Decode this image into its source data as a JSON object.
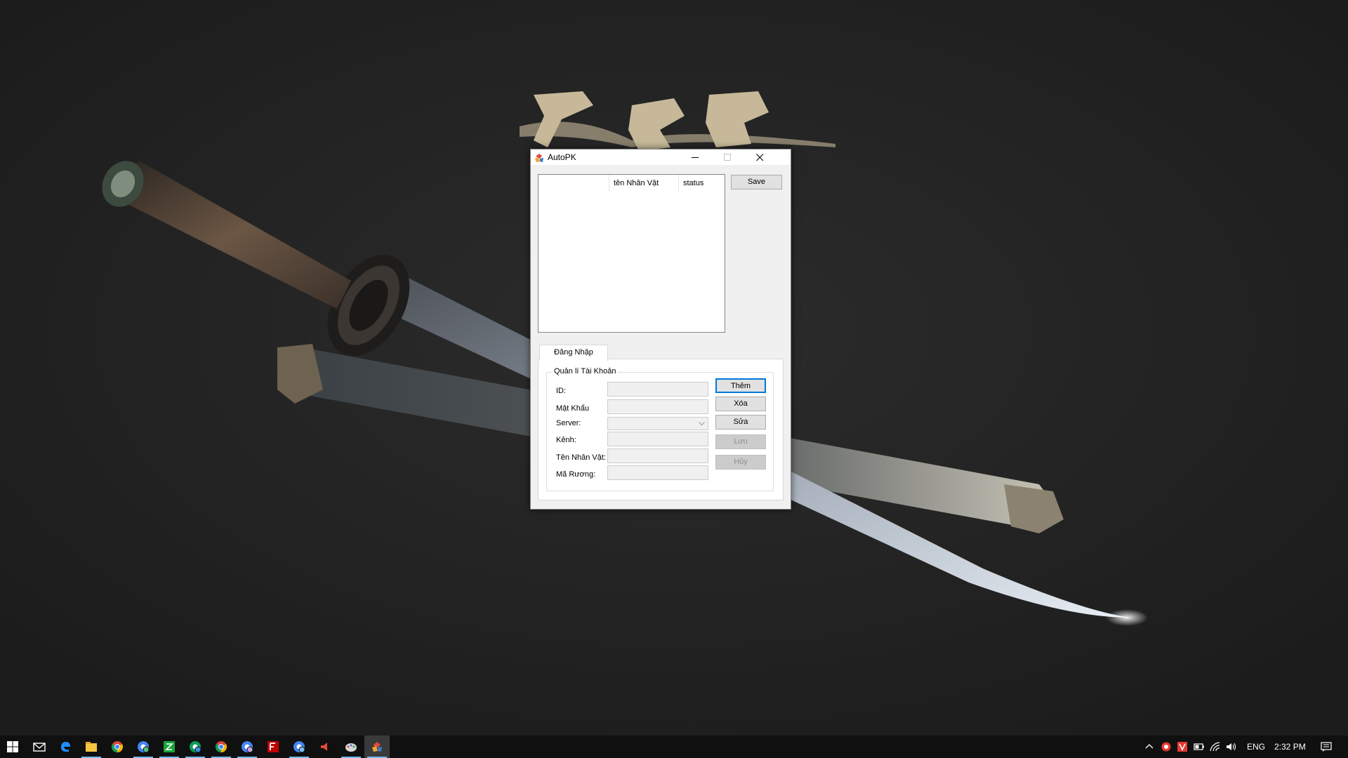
{
  "window": {
    "title": "AutoPK",
    "icon": "app-logo-icon",
    "controls": [
      "minimize-icon",
      "maximize-icon",
      "close-icon"
    ]
  },
  "listview": {
    "columns": [
      "",
      "tên Nhân Vật",
      "status"
    ],
    "rows": []
  },
  "toolbar": {
    "save_label": "Save"
  },
  "tabs": [
    {
      "label": "Đăng Nhập",
      "selected": true
    }
  ],
  "account_group": {
    "title": "Quản lí Tài Khoản",
    "fields": {
      "id": {
        "label": "ID:",
        "value": ""
      },
      "password": {
        "label": "Mật Khẩu",
        "value": ""
      },
      "server": {
        "label": "Server:",
        "value": ""
      },
      "channel": {
        "label": "Kênh:",
        "value": ""
      },
      "character": {
        "label": "Tên Nhân Vật:",
        "value": ""
      },
      "chest_code": {
        "label": "Mã Rương:",
        "value": ""
      }
    },
    "buttons": {
      "add": {
        "label": "Thêm",
        "enabled": true,
        "default": true
      },
      "delete": {
        "label": "Xóa",
        "enabled": true
      },
      "edit": {
        "label": "Sửa",
        "enabled": true
      },
      "save": {
        "label": "Lưu",
        "enabled": false
      },
      "cancel": {
        "label": "Hủy",
        "enabled": false
      }
    }
  },
  "taskbar": {
    "pinned": [
      "start-icon",
      "mail-icon",
      "edge-icon",
      "file-explorer-icon",
      "chrome-icon",
      "chrome-profile-icon",
      "green-app-icon",
      "chrome-profile-icon",
      "chrome-icon",
      "chrome-profile-icon",
      "filezilla-icon",
      "chrome-profile-icon",
      "media-app-icon",
      "paint-icon",
      "autopk-icon"
    ],
    "tray": {
      "icons": [
        "chevron-up-icon",
        "antivirus-icon",
        "vietkey-icon",
        "battery-icon",
        "wifi-icon",
        "volume-icon"
      ],
      "language": "ENG",
      "time": "2:32 PM"
    },
    "notification_icon": "action-center-icon"
  },
  "colors": {
    "accent": "#0078d7",
    "taskbar": "#101010",
    "window_bg": "#f0f0f0"
  }
}
